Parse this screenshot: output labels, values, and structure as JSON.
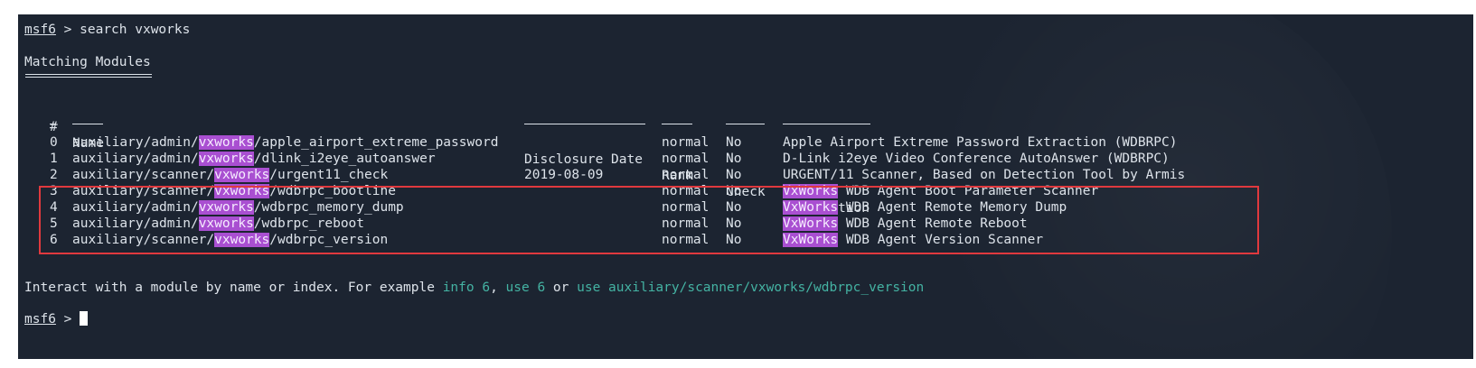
{
  "prompt1": {
    "user": "msf6",
    "sep": " > ",
    "command": "search vxworks"
  },
  "section_title": "Matching Modules",
  "table": {
    "headers": {
      "num": "#",
      "name": "Name",
      "date": "Disclosure Date",
      "rank": "Rank",
      "check": "Check",
      "desc": "Description"
    },
    "rows": [
      {
        "num": "0",
        "name_pre": "auxiliary/admin/",
        "name_hl": "vxworks",
        "name_post": "/apple_airport_extreme_password",
        "date": "",
        "rank": "normal",
        "check": "No",
        "desc_hl": "",
        "desc": "Apple Airport Extreme Password Extraction (WDBRPC)"
      },
      {
        "num": "1",
        "name_pre": "auxiliary/admin/",
        "name_hl": "vxworks",
        "name_post": "/dlink_i2eye_autoanswer",
        "date": "",
        "rank": "normal",
        "check": "No",
        "desc_hl": "",
        "desc": "D-Link i2eye Video Conference AutoAnswer (WDBRPC)"
      },
      {
        "num": "2",
        "name_pre": "auxiliary/scanner/",
        "name_hl": "vxworks",
        "name_post": "/urgent11_check",
        "date": "2019-08-09",
        "rank": "normal",
        "check": "No",
        "desc_hl": "",
        "desc": "URGENT/11 Scanner, Based on Detection Tool by Armis"
      },
      {
        "num": "3",
        "name_pre": "auxiliary/scanner/",
        "name_hl": "vxworks",
        "name_post": "/wdbrpc_bootline",
        "date": "",
        "rank": "normal",
        "check": "No",
        "desc_hl": "VxWorks",
        "desc": " WDB Agent Boot Parameter Scanner"
      },
      {
        "num": "4",
        "name_pre": "auxiliary/admin/",
        "name_hl": "vxworks",
        "name_post": "/wdbrpc_memory_dump",
        "date": "",
        "rank": "normal",
        "check": "No",
        "desc_hl": "VxWorks",
        "desc": " WDB Agent Remote Memory Dump"
      },
      {
        "num": "5",
        "name_pre": "auxiliary/admin/",
        "name_hl": "vxworks",
        "name_post": "/wdbrpc_reboot",
        "date": "",
        "rank": "normal",
        "check": "No",
        "desc_hl": "VxWorks",
        "desc": " WDB Agent Remote Reboot"
      },
      {
        "num": "6",
        "name_pre": "auxiliary/scanner/",
        "name_hl": "vxworks",
        "name_post": "/wdbrpc_version",
        "date": "",
        "rank": "normal",
        "check": "No",
        "desc_hl": "VxWorks",
        "desc": " WDB Agent Version Scanner"
      }
    ]
  },
  "interact": {
    "text1": "Interact with a module by name or index. For example ",
    "cmd1": "info 6",
    "sep1": ", ",
    "cmd2": "use 6",
    "text2": " or ",
    "cmd3": "use auxiliary/scanner/vxworks/wdbrpc_version"
  },
  "prompt2": {
    "user": "msf6",
    "sep": " > "
  },
  "colors": {
    "background": "#1c2431",
    "highlight": "#a94fd1",
    "command": "#44b3a3",
    "annotation_box": "#e0393e"
  }
}
